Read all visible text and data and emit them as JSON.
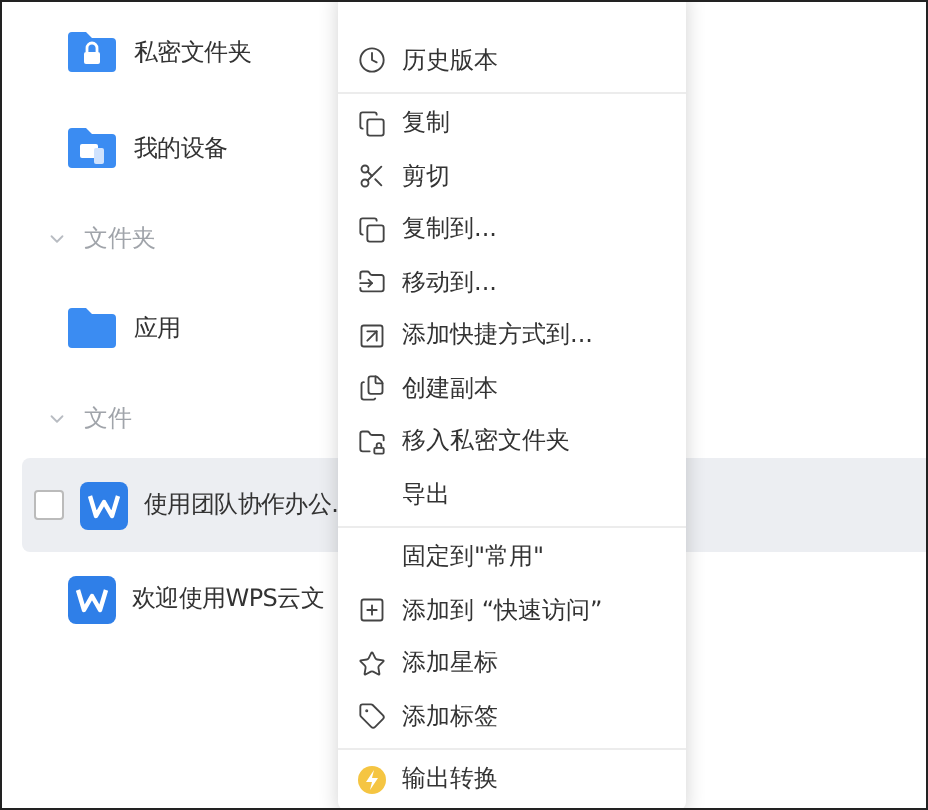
{
  "file_list": [
    {
      "kind": "private-folder",
      "name": "私密文件夹"
    },
    {
      "kind": "device",
      "name": "我的设备"
    },
    {
      "kind": "section",
      "name": "文件夹"
    },
    {
      "kind": "folder",
      "name": "应用"
    },
    {
      "kind": "section",
      "name": "文件"
    },
    {
      "kind": "document",
      "name": "使用团队协作办公.",
      "selected": true,
      "checked": false
    },
    {
      "kind": "document",
      "name": "欢迎使用WPS云文",
      "selected": false
    }
  ],
  "context_menu": {
    "groups": [
      [
        {
          "label": "历史版本"
        }
      ],
      [
        {
          "label": "复制"
        },
        {
          "label": "剪切"
        },
        {
          "label": "复制到..."
        },
        {
          "label": "移动到..."
        },
        {
          "label": "添加快捷方式到..."
        },
        {
          "label": "创建副本"
        },
        {
          "label": "移入私密文件夹"
        },
        {
          "label": "导出"
        }
      ],
      [
        {
          "label": "固定到\"常用\""
        },
        {
          "label": "添加到 “快速访问”"
        },
        {
          "label": "添加星标"
        },
        {
          "label": "添加标签"
        }
      ],
      [
        {
          "label": "输出转换"
        }
      ]
    ]
  }
}
